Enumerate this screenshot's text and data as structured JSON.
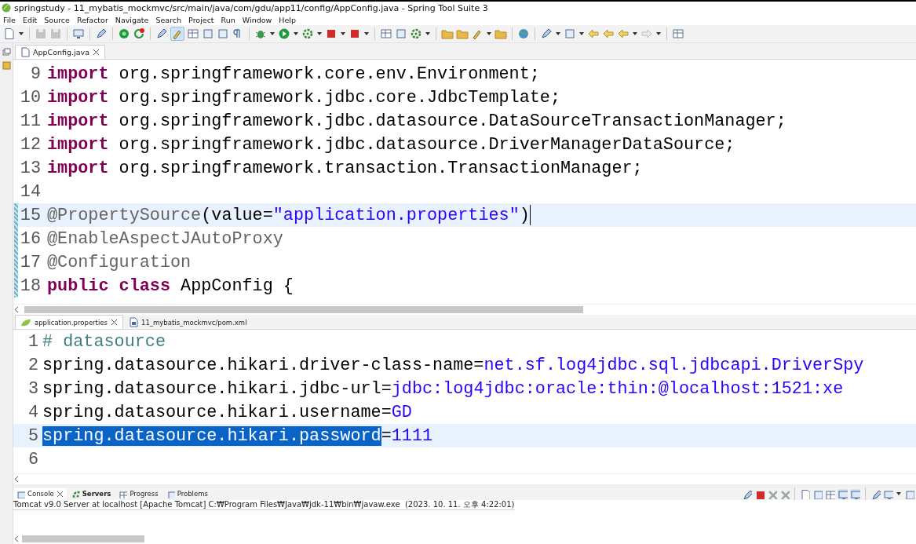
{
  "window": {
    "title": "springstudy - 11_mybatis_mockmvc/src/main/java/com/gdu/app11/config/AppConfig.java - Spring Tool Suite 3"
  },
  "menu": [
    "File",
    "Edit",
    "Source",
    "Refactor",
    "Navigate",
    "Search",
    "Project",
    "Run",
    "Window",
    "Help"
  ],
  "java_editor": {
    "tabs": [
      {
        "label": "AppConfig.java",
        "selected": true
      }
    ],
    "lines": [
      {
        "number": "9",
        "current": false,
        "changed": false,
        "tokens": [
          {
            "kind": "keyword",
            "text": "import"
          },
          {
            "kind": "plain",
            "text": " org.springframework.core.env.Environment;"
          }
        ]
      },
      {
        "number": "10",
        "current": false,
        "changed": false,
        "tokens": [
          {
            "kind": "keyword",
            "text": "import"
          },
          {
            "kind": "plain",
            "text": " org.springframework.jdbc.core.JdbcTemplate;"
          }
        ]
      },
      {
        "number": "11",
        "current": false,
        "changed": false,
        "tokens": [
          {
            "kind": "keyword",
            "text": "import"
          },
          {
            "kind": "plain",
            "text": " org.springframework.jdbc.datasource.DataSourceTransactionManager;"
          }
        ]
      },
      {
        "number": "12",
        "current": false,
        "changed": false,
        "tokens": [
          {
            "kind": "keyword",
            "text": "import"
          },
          {
            "kind": "plain",
            "text": " org.springframework.jdbc.datasource.DriverManagerDataSource;"
          }
        ]
      },
      {
        "number": "13",
        "current": false,
        "changed": false,
        "tokens": [
          {
            "kind": "keyword",
            "text": "import"
          },
          {
            "kind": "plain",
            "text": " org.springframework.transaction.TransactionManager;"
          }
        ]
      },
      {
        "number": "14",
        "current": false,
        "changed": false
      },
      {
        "number": "15",
        "current": true,
        "changed": true,
        "tokens": [
          {
            "kind": "annotation",
            "text": "@PropertySource"
          },
          {
            "kind": "plain",
            "text": "(value="
          },
          {
            "kind": "string",
            "text": "\"application.properties\""
          },
          {
            "kind": "plain",
            "text": ")"
          }
        ]
      },
      {
        "number": "16",
        "current": false,
        "changed": true,
        "tokens": [
          {
            "kind": "annotation",
            "text": "@EnableAspectJAutoProxy"
          }
        ]
      },
      {
        "number": "17",
        "current": false,
        "changed": true,
        "tokens": [
          {
            "kind": "annotation",
            "text": "@Configuration"
          }
        ]
      },
      {
        "number": "18",
        "current": false,
        "changed": true,
        "tokens": [
          {
            "kind": "keyword",
            "text": "public"
          },
          {
            "kind": "keyword",
            "text": " class"
          },
          {
            "kind": "plain",
            "text": " AppConfig {"
          }
        ]
      }
    ]
  },
  "properties_editor": {
    "tabs": [
      {
        "label": "application.properties",
        "selected": true
      },
      {
        "label": "11_mybatis_mockmvc/pom.xml",
        "selected": false
      }
    ],
    "lines": [
      {
        "number": "1",
        "current": false,
        "changed": false,
        "tokens": [
          {
            "kind": "comment",
            "text": "# datasource",
            "selected": false
          }
        ]
      },
      {
        "number": "2",
        "current": false,
        "changed": false,
        "tokens": [
          {
            "kind": "plain",
            "text": "spring.datasource.hikari.driver-class-name=",
            "selected": false
          },
          {
            "kind": "string",
            "text": "net.sf.log4jdbc.sql.jdbcapi.DriverSpy",
            "selected": false
          }
        ]
      },
      {
        "number": "3",
        "current": false,
        "changed": false,
        "tokens": [
          {
            "kind": "plain",
            "text": "spring.datasource.hikari.jdbc-url=",
            "selected": false
          },
          {
            "kind": "string",
            "text": "jdbc:log4jdbc:oracle:thin:@localhost:1521:xe",
            "selected": false
          }
        ]
      },
      {
        "number": "4",
        "current": false,
        "changed": false,
        "tokens": [
          {
            "kind": "plain",
            "text": "spring.datasource.hikari.username=",
            "selected": false
          },
          {
            "kind": "string",
            "text": "GD",
            "selected": false
          }
        ]
      },
      {
        "number": "5",
        "current": true,
        "changed": false,
        "tokens": [
          {
            "kind": "plain",
            "text": "spring.datasource.hikari.password",
            "selected": true
          },
          {
            "kind": "plain",
            "text": "=",
            "selected": false
          },
          {
            "kind": "string",
            "text": "1111",
            "selected": false
          }
        ]
      },
      {
        "number": "6",
        "current": false,
        "changed": false
      }
    ]
  },
  "console": {
    "tabs": [
      {
        "label": "Console",
        "selected": true,
        "bold": false
      },
      {
        "label": "Servers",
        "selected": false,
        "bold": true
      },
      {
        "label": "Progress",
        "selected": false,
        "bold": false
      },
      {
        "label": "Problems",
        "selected": false,
        "bold": false
      }
    ],
    "status": "Tomcat v9.0 Server at localhost [Apache Tomcat] C:₩Program Files₩Java₩jdk-11₩bin₩javaw.exe  (2023. 10. 11. 오후 4:22:01)"
  }
}
